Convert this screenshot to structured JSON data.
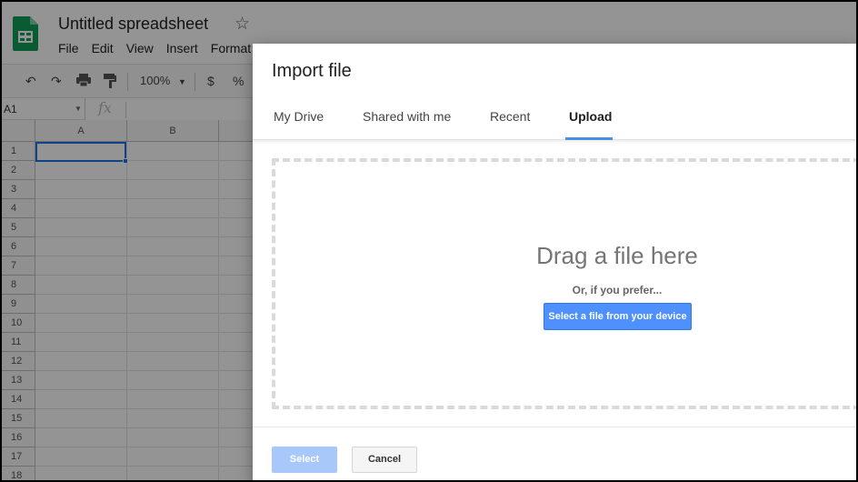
{
  "app": {
    "doc_title": "Untitled spreadsheet",
    "menu": [
      "File",
      "Edit",
      "View",
      "Insert",
      "Format"
    ],
    "zoom": "100%",
    "currency_symbol": "$",
    "percent_symbol": "%",
    "cell_ref": "A1",
    "fx_label": "fx",
    "columns": [
      "A",
      "B"
    ],
    "rows": [
      "1",
      "2",
      "3",
      "4",
      "5",
      "6",
      "7",
      "8",
      "9",
      "10",
      "11",
      "12",
      "13",
      "14",
      "15",
      "16",
      "17",
      "18"
    ]
  },
  "dialog": {
    "title": "Import file",
    "tabs": [
      "My Drive",
      "Shared with me",
      "Recent",
      "Upload"
    ],
    "active_tab": "Upload",
    "drag_text": "Drag a file here",
    "prefer_text": "Or, if you prefer...",
    "select_device_label": "Select a file from your device",
    "select_label": "Select",
    "cancel_label": "Cancel"
  },
  "colors": {
    "accent": "#4d90fe",
    "tab_underline": "#4a90e2",
    "disabled_button": "#a8c7fa",
    "sheets_green": "#0f9d58"
  },
  "icons": [
    "sheets-logo-icon",
    "star-icon",
    "undo-icon",
    "redo-icon",
    "print-icon",
    "paint-format-icon",
    "dropdown-caret-icon"
  ]
}
